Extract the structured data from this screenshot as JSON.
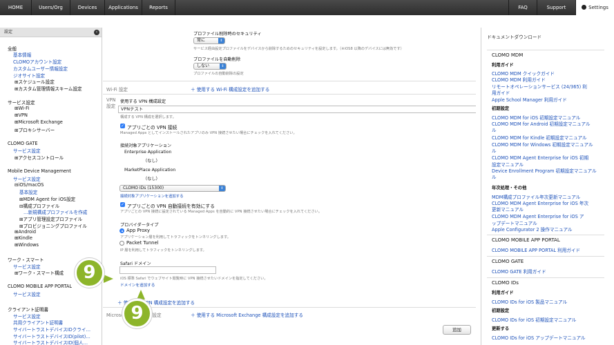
{
  "nav": {
    "items": [
      "HOME",
      "Users/Org",
      "Devices",
      "Applications",
      "Reports"
    ],
    "faq": "FAQ",
    "support": "Support",
    "settings": "Settings"
  },
  "sidebar": {
    "title": "設定",
    "general": {
      "heading": "全般",
      "links": [
        "基本情報",
        "CLOMOアカウント設定",
        "カスタムユーザー情報設定",
        "ジオサイト設定"
      ],
      "schedule": "スケジュール設定",
      "custom_schema": "カスタム管理情報スキーム設定"
    },
    "service_settings": {
      "heading": "サービス設定",
      "items": [
        "Wi-Fi",
        "VPN",
        "Microsoft Exchange",
        "プロキシサーバー"
      ]
    },
    "gate": {
      "heading": "CLOMO GATE",
      "link": "サービス設定",
      "item": "アクセスコントロール"
    },
    "mdm": {
      "heading": "Mobile Device Management",
      "link": "サービス設定",
      "ios": "iOS/macOS",
      "basic": "基本設定",
      "agent": "MDM Agent for iOS設定",
      "profile": "構成プロファイル",
      "new_profile": "…新規構成プロファイルを作成",
      "app_profile": "アプリ管理設定プロファイル",
      "provisioning": "プロビジョニングプロファイル",
      "android": "Android",
      "kindle": "Kindle",
      "windows": "Windows"
    },
    "worksmart": {
      "heading": "ワーク・スマート",
      "link": "サービス設定",
      "item": "ワーク・スマート構成"
    },
    "portal": {
      "heading": "CLOMO MOBILE APP PORTAL",
      "link": "サービス設定"
    },
    "cert": {
      "heading": "クライアント証明書",
      "links": [
        "サービス設定",
        "共用クライアント証明書",
        "サイバートラストデバイスIDクライ…",
        "サイバートラストデバイスID(pilot)…",
        "サイバートラストデバイスID(個人…"
      ]
    }
  },
  "main": {
    "security_label": "プロファイル削除時のセキュリティ",
    "security_value": "常に",
    "security_help": "サービス経由設定プロファイルをデバイスから削除するためのセキュリティを設定します。（※iOS8 以降のデバイスには無効です）",
    "autodelete_label": "プロファイルを自動削除",
    "autodelete_value": "しない",
    "autodelete_help": "プロファイルの自動削除の設定",
    "wifi_group": "Wi-Fi 設定",
    "wifi_add": "＋ 使用する Wi-Fi 構成設定を追加する",
    "vpn_group": "VPN 設定",
    "vpn_config_label": "使用する VPN 構成設定",
    "vpn_config_value": "VPNテスト",
    "vpn_config_help": "構成する VPN 構成を選択します。",
    "per_app_label": "アプリごとの VPN 接続",
    "per_app_help": "Managed Apps としてインストールされたアプリのみ VPN 接続させたい場合にチェックを入れてください。",
    "target_apps_label": "接続対象アプリケーション",
    "enterprise_label": "Enterprise Application",
    "enterprise_value": "（なし）",
    "marketplace_label": "MarketPlace Application",
    "marketplace_value": "（なし）",
    "ids_value": "CLOMO IDs (15300)",
    "add_target": "接続対象アプリケーションを追加する",
    "auto_connect_label": "アプリごとの VPN 自動接続を有効にする",
    "auto_connect_help": "アプリごとの VPN 接続に設定されている Managed Apps を自動的に VPN 接続させたい場合にチェックを入れてください。",
    "provider_label": "プロバイダータイプ",
    "app_proxy": "App Proxy",
    "app_proxy_help": "アプリケーション層を利用してトラフィックをトンネリングします。",
    "packet_tunnel": "Packet Tunnel",
    "packet_tunnel_help": "IP 層を利用してトラフィックをトンネリングします。",
    "safari_label": "Safari ドメイン",
    "safari_help": "iOS 標準 Safari でウェブサイト閲覧時に VPN 接続させたいドメインを指定してください。",
    "add_domain": "ドメインを追加する",
    "vpn_add": "＋ 使用する VPN 構成設定を追加する",
    "exchange_group": "Microsoft Exchange 設定",
    "exchange_add": "＋ 使用する Microsoft Exchange 構成設定を追加する",
    "add_button": "追加"
  },
  "badges": {
    "upper": "9",
    "lower": "9"
  },
  "right": {
    "title": "ドキュメントダウンロード",
    "mdm": {
      "heading": "CLOMO MDM",
      "guide_label": "利用ガイド",
      "guide": [
        "CLOMO MDM クイックガイド",
        "CLOMO MDM 利用ガイド",
        "リモートオペレーションサービス (24/365) 利",
        "用ガイド",
        "Apple School Manager 利用ガイド"
      ],
      "init_label": "初期設定",
      "init": [
        "CLOMO MDM for iOS 初期設定マニュアル",
        "CLOMO MDM for Android 初期設定マニュアル",
        "ル",
        "CLOMO MDM for Kindle 初期設定マニュアル",
        "CLOMO MDM for Windows 初期設定マニュアル",
        "ル",
        "CLOMO MDM Agent Enterprise for iOS 初期",
        "設定マニュアル",
        "Device Enrollment Program 初期設定マニュアル",
        "ル"
      ],
      "year_label": "年次処理・その他",
      "year": [
        "MDM構成プロファイル年次更新マニュアル",
        "CLOMO MDM Agent Enterprise for iOS 年次",
        "更新マニュアル",
        "CLOMO MDM Agent Enterprise for iOS ア",
        "ップデートマニュアル",
        "Apple Configurator 2 操作マニュアル"
      ]
    },
    "portal": {
      "heading": "CLOMO MOBILE APP PORTAL",
      "link": "CLOMO MOBILE APP PORTAL 利用ガイド"
    },
    "gate": {
      "heading": "CLOMO GATE",
      "link": "CLOMO GATE 利用ガイド"
    },
    "ids": {
      "heading": "CLOMO IDs",
      "guide_label": "利用ガイド",
      "guide": "CLOMO IDs for iOS 製品マニュアル",
      "init_label": "初期設定",
      "init": "CLOMO IDs for iOS 初期設定マニュアル",
      "update_label": "更新する",
      "update": "CLOMO IDs for iOS アップデートマニュアル"
    }
  }
}
